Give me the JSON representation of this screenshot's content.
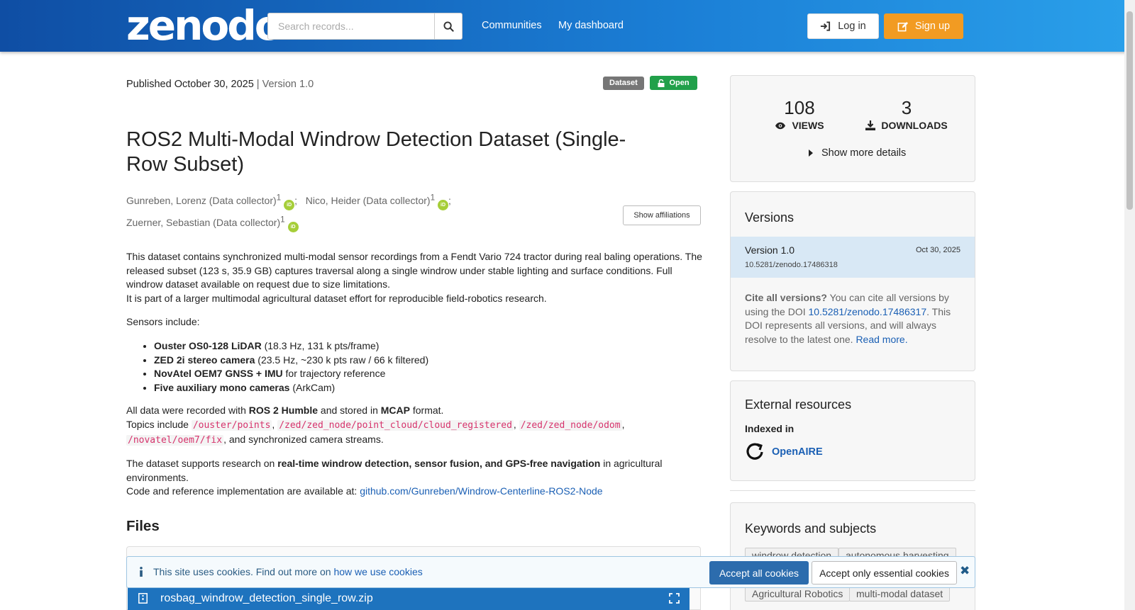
{
  "header": {
    "logo": "zenodo",
    "search_placeholder": "Search records...",
    "nav": {
      "communities": "Communities",
      "dashboard": "My dashboard"
    },
    "login": "Log in",
    "signup": "Sign up"
  },
  "record": {
    "published": "Published October 30, 2025",
    "version": "| Version 1.0",
    "badge_type": "Dataset",
    "badge_access": "Open",
    "title": "ROS2 Multi-Modal Windrow Detection Dataset (Single-Row Subset)",
    "creators": [
      {
        "name": "Gunreben, Lorenz (Data collector)",
        "sup": "1",
        "sep": ";"
      },
      {
        "name": "Nico, Heider (Data collector)",
        "sup": "1",
        "sep": ";"
      },
      {
        "name": "Zuerner, Sebastian (Data collector)",
        "sup": "1",
        "sep": ""
      }
    ],
    "show_affiliations": "Show affiliations",
    "orcid": "iD"
  },
  "description": {
    "p1": "This dataset contains synchronized multi-modal sensor recordings from a Fendt Vario 724 tractor during real baling operations. The released subset (123 s, 35.9 GB) captures traversal along a single windrow under stable lighting and surface conditions. Full windrow dataset available on request due to size limitations.",
    "p1b": "It is part of a larger multimodal agricultural dataset effort for reproducible field-robotics research.",
    "sensors_intro": "Sensors include:",
    "sensors": [
      {
        "b": "Ouster OS0-128 LiDAR",
        "t": " (18.3 Hz, 131 k pts/frame)"
      },
      {
        "b": "ZED 2i stereo camera",
        "t": " (23.5 Hz, ~230 k pts raw / 66 k filtered)"
      },
      {
        "b": "NovAtel OEM7 GNSS + IMU",
        "t": " for trajectory reference"
      },
      {
        "b": "Five auxiliary mono cameras",
        "t": " (ArkCam)"
      }
    ],
    "recorded_a": "All data were recorded with ",
    "recorded_b": "ROS 2 Humble",
    "recorded_c": " and stored in ",
    "recorded_d": "MCAP",
    "recorded_e": " format.",
    "topics_a": "Topics include ",
    "topics": [
      "/ouster/points",
      "/zed/zed_node/point_cloud/cloud_registered",
      "/zed/zed_node/odom",
      "/novatel/oem7/fix"
    ],
    "topics_end": ", and synchronized camera streams.",
    "supports_a": "The dataset supports research on ",
    "supports_b": "real-time windrow detection, sensor fusion, and GPS-free navigation",
    "supports_c": " in agricultural environments.",
    "code_a": "Code and reference implementation are available at: ",
    "code_link": "github.com/Gunreben/Windrow-Centerline-ROS2-Node"
  },
  "files": {
    "title": "Files",
    "filename": "rosbag_windrow_detection_single_row.zip"
  },
  "stats": {
    "views": "108",
    "views_label": "VIEWS",
    "downloads": "3",
    "downloads_label": "DOWNLOADS",
    "more": "Show more details"
  },
  "versions": {
    "title": "Versions",
    "name": "Version 1.0",
    "date": "Oct 30, 2025",
    "doi": "10.5281/zenodo.17486318",
    "cite_b": "Cite all versions?",
    "cite_a": " You can cite all versions by using the DOI ",
    "cite_doi": "10.5281/zenodo.17486317",
    "cite_c": ". This DOI represents all versions, and will always resolve to the latest one. ",
    "read_more": "Read more."
  },
  "external": {
    "title": "External resources",
    "indexed": "Indexed in",
    "openaire": "OpenAIRE"
  },
  "keywords": {
    "title": "Keywords and subjects",
    "tags": [
      "windrow detection",
      "autonomous harvesting",
      "Agricultural Robotics",
      "multi-modal dataset"
    ]
  },
  "cookie": {
    "text": "This site uses cookies. Find out more on ",
    "link": "how we use cookies",
    "accept_all": "Accept all cookies",
    "accept_essential": "Accept only essential cookies"
  },
  "colors": {
    "header": "#1b7fd6",
    "signup": "#f29b22",
    "open": "#21a04a",
    "link": "#1a5fb4"
  }
}
